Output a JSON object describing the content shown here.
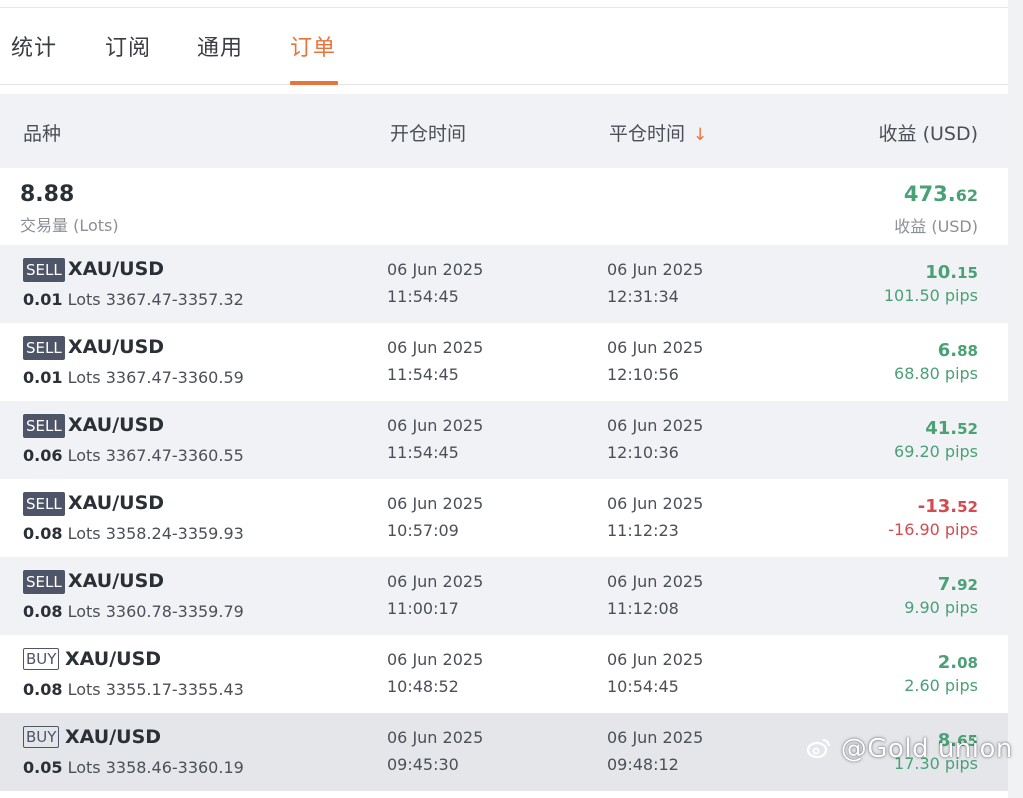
{
  "tabs": [
    {
      "label": "统计",
      "active": false
    },
    {
      "label": "订阅",
      "active": false
    },
    {
      "label": "通用",
      "active": false
    },
    {
      "label": "订单",
      "active": true
    }
  ],
  "columns": {
    "symbol": "品种",
    "open_time": "开仓时间",
    "close_time": "平仓时间",
    "sort_indicator": "↓",
    "profit": "收益 (USD)"
  },
  "summary": {
    "lots": "8.88",
    "lots_label": "交易量 (Lots)",
    "profit_int": "473.",
    "profit_dec": "62",
    "profit_label": "收益 (USD)"
  },
  "orders": [
    {
      "side": "SELL",
      "symbol": "XAU/USD",
      "lots": "0.01",
      "lots_unit": "Lots",
      "prices": "3367.47-3357.32",
      "open_date": "06 Jun 2025",
      "open_time": "11:54:45",
      "close_date": "06 Jun 2025",
      "close_time": "12:31:34",
      "profit_int": "10.",
      "profit_dec": "15",
      "pips": "101.50 pips",
      "status": "positive"
    },
    {
      "side": "SELL",
      "symbol": "XAU/USD",
      "lots": "0.01",
      "lots_unit": "Lots",
      "prices": "3367.47-3360.59",
      "open_date": "06 Jun 2025",
      "open_time": "11:54:45",
      "close_date": "06 Jun 2025",
      "close_time": "12:10:56",
      "profit_int": "6.",
      "profit_dec": "88",
      "pips": "68.80 pips",
      "status": "positive"
    },
    {
      "side": "SELL",
      "symbol": "XAU/USD",
      "lots": "0.06",
      "lots_unit": "Lots",
      "prices": "3367.47-3360.55",
      "open_date": "06 Jun 2025",
      "open_time": "11:54:45",
      "close_date": "06 Jun 2025",
      "close_time": "12:10:36",
      "profit_int": "41.",
      "profit_dec": "52",
      "pips": "69.20 pips",
      "status": "positive"
    },
    {
      "side": "SELL",
      "symbol": "XAU/USD",
      "lots": "0.08",
      "lots_unit": "Lots",
      "prices": "3358.24-3359.93",
      "open_date": "06 Jun 2025",
      "open_time": "10:57:09",
      "close_date": "06 Jun 2025",
      "close_time": "11:12:23",
      "profit_int": "-13.",
      "profit_dec": "52",
      "pips": "-16.90 pips",
      "status": "negative"
    },
    {
      "side": "SELL",
      "symbol": "XAU/USD",
      "lots": "0.08",
      "lots_unit": "Lots",
      "prices": "3360.78-3359.79",
      "open_date": "06 Jun 2025",
      "open_time": "11:00:17",
      "close_date": "06 Jun 2025",
      "close_time": "11:12:08",
      "profit_int": "7.",
      "profit_dec": "92",
      "pips": "9.90 pips",
      "status": "positive"
    },
    {
      "side": "BUY",
      "symbol": "XAU/USD",
      "lots": "0.08",
      "lots_unit": "Lots",
      "prices": "3355.17-3355.43",
      "open_date": "06 Jun 2025",
      "open_time": "10:48:52",
      "close_date": "06 Jun 2025",
      "close_time": "10:54:45",
      "profit_int": "2.",
      "profit_dec": "08",
      "pips": "2.60 pips",
      "status": "positive"
    },
    {
      "side": "BUY",
      "symbol": "XAU/USD",
      "lots": "0.05",
      "lots_unit": "Lots",
      "prices": "3358.46-3360.19",
      "open_date": "06 Jun 2025",
      "open_time": "09:45:30",
      "close_date": "06 Jun 2025",
      "close_time": "09:48:12",
      "profit_int": "8.",
      "profit_dec": "65",
      "pips": "17.30 pips",
      "status": "positive"
    }
  ],
  "colors": {
    "accent": "#e8743b",
    "profit_positive": "#4aa176",
    "profit_negative": "#d54a4f",
    "side_badge": "#4e5568"
  },
  "watermark": {
    "icon": "weibo-logo-icon",
    "text": "@Gold union"
  }
}
